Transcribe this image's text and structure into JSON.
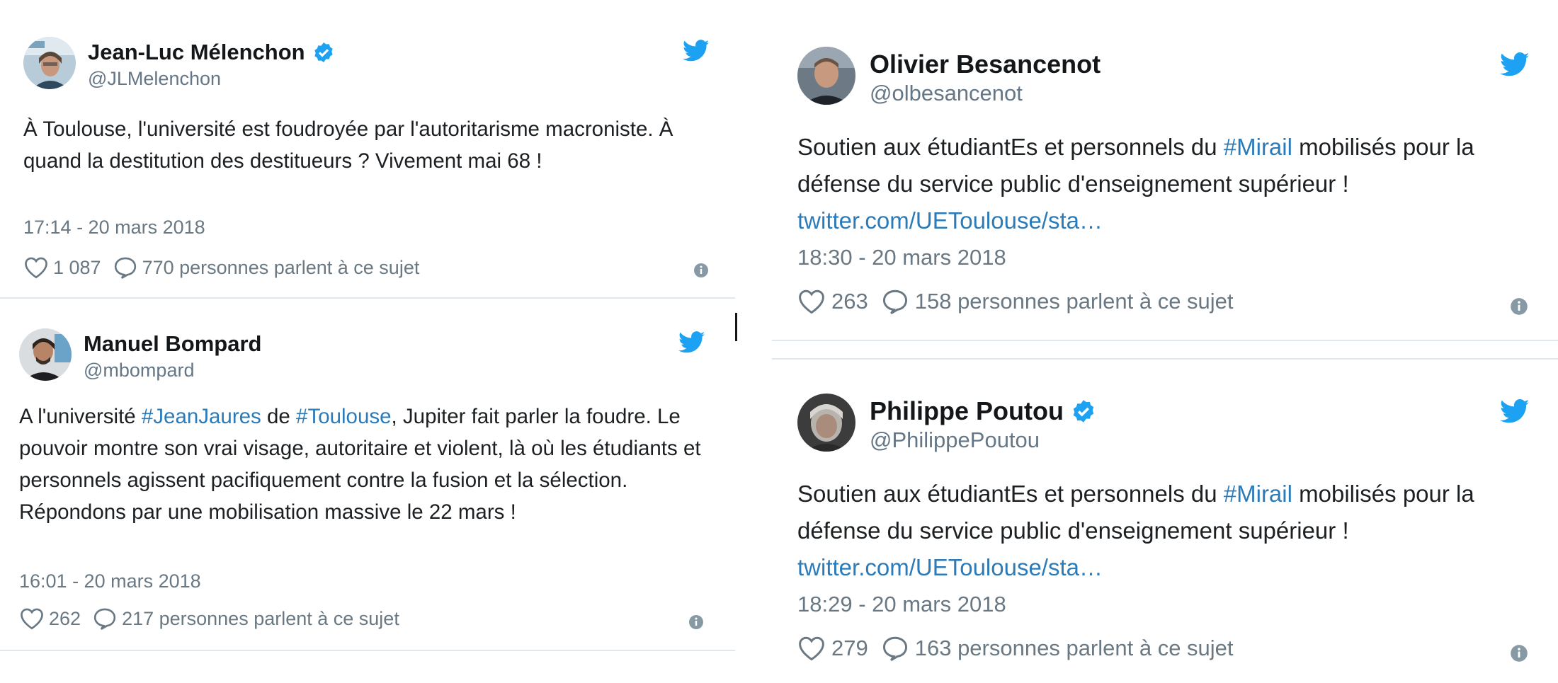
{
  "colors": {
    "link": "#2b7bb9",
    "verified": "#1da1f2",
    "twitter_blue": "#1da1f2",
    "meta": "#697882",
    "text": "#1c2022"
  },
  "icons": {
    "brand": "twitter-bird-icon",
    "verified": "verified-badge-icon",
    "like": "heart-icon",
    "reply": "speech-bubble-icon",
    "info": "info-icon"
  },
  "tweets": [
    {
      "author": {
        "name": "Jean-Luc Mélenchon",
        "handle": "@JLMelenchon",
        "verified": true
      },
      "segments": [
        {
          "text": "À Toulouse, l'université est foudroyée par l'autoritarisme macroniste. À quand la destitution des destitueurs ? Vivement mai 68 !",
          "type": "text"
        }
      ],
      "timestamp": "17:14 - 20 mars 2018",
      "likes": "1 087",
      "replies_text": "770 personnes parlent à ce sujet"
    },
    {
      "author": {
        "name": "Manuel Bompard",
        "handle": "@mbompard",
        "verified": false
      },
      "segments": [
        {
          "text": "A l'université ",
          "type": "text"
        },
        {
          "text": "#JeanJaures",
          "type": "hashtag"
        },
        {
          "text": " de ",
          "type": "text"
        },
        {
          "text": "#Toulouse",
          "type": "hashtag"
        },
        {
          "text": ", Jupiter fait parler la foudre. Le pouvoir montre son vrai visage, autoritaire et violent, là où les étudiants et personnels agissent pacifiquement contre la fusion et la sélection. Répondons par une mobilisation massive le 22 mars !",
          "type": "text"
        }
      ],
      "timestamp": "16:01 - 20 mars 2018",
      "likes": "262",
      "replies_text": "217 personnes parlent à ce sujet"
    },
    {
      "author": {
        "name": "Olivier Besancenot",
        "handle": "@olbesancenot",
        "verified": false
      },
      "segments": [
        {
          "text": "Soutien aux étudiantEs et personnels du ",
          "type": "text"
        },
        {
          "text": "#Mirail",
          "type": "hashtag"
        },
        {
          "text": " mobilisés pour la défense du service public d'enseignement supérieur !",
          "type": "text"
        }
      ],
      "link": "twitter.com/UEToulouse/sta…",
      "timestamp": "18:30 - 20 mars 2018",
      "likes": "263",
      "replies_text": "158 personnes parlent à ce sujet"
    },
    {
      "author": {
        "name": "Philippe Poutou",
        "handle": "@PhilippePoutou",
        "verified": true
      },
      "segments": [
        {
          "text": "Soutien aux étudiantEs et personnels du ",
          "type": "text"
        },
        {
          "text": "#Mirail",
          "type": "hashtag"
        },
        {
          "text": " mobilisés pour la défense du service public d'enseignement supérieur !",
          "type": "text"
        }
      ],
      "link": "twitter.com/UEToulouse/sta…",
      "timestamp": "18:29 - 20 mars 2018",
      "likes": "279",
      "replies_text": "163 personnes parlent à ce sujet"
    }
  ]
}
